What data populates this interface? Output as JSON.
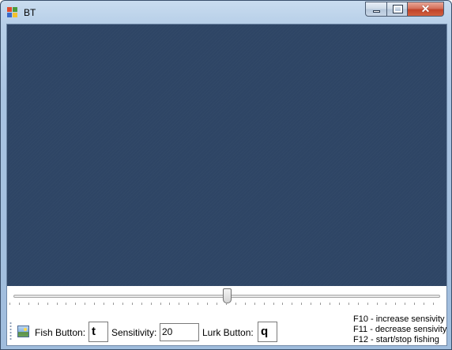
{
  "window": {
    "title": "BT",
    "controls": {
      "minimize": "",
      "maximize": "",
      "close": "✕"
    }
  },
  "slider": {
    "value_fraction": 0.5,
    "tick_count": 46
  },
  "toolstrip": {
    "fish_button_label": "Fish Button:",
    "fish_button_value": "t",
    "sensitivity_label": "Sensitivity:",
    "sensitivity_value": "20",
    "lurk_button_label": "Lurk Button:",
    "lurk_button_value": "q"
  },
  "hotkeys": [
    "F10 - increase sensivity",
    "F11 - decrease sensivity",
    "F12 - start/stop fishing"
  ],
  "colors": {
    "canvas": "#2e4565",
    "close": "#c0432a"
  },
  "icons": {
    "app": "app-icon",
    "image": "image-icon"
  }
}
